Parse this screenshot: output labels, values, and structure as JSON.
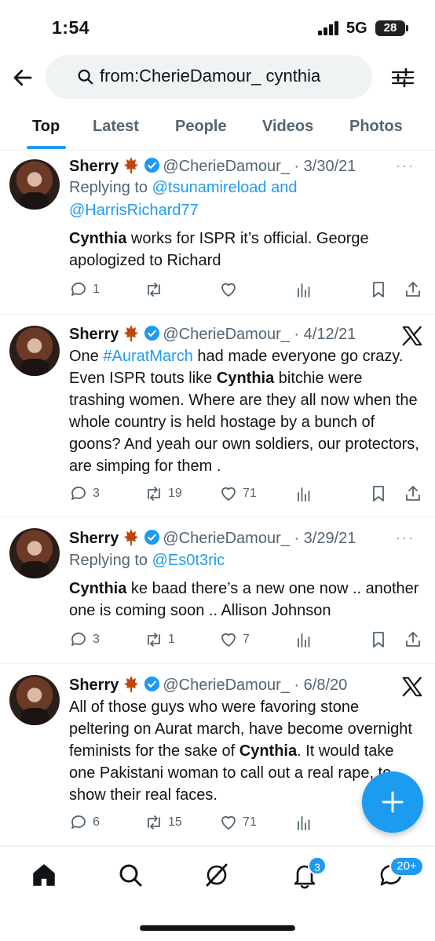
{
  "status": {
    "time": "1:54",
    "network": "5G",
    "battery": "28"
  },
  "search": {
    "query": "from:CherieDamour_ cynthia"
  },
  "tabs": [
    {
      "label": "Top"
    },
    {
      "label": "Latest"
    },
    {
      "label": "People"
    },
    {
      "label": "Videos"
    },
    {
      "label": "Photos"
    }
  ],
  "tweets": [
    {
      "name": "Sherry",
      "handle": "@CherieDamour_",
      "date": "3/30/21",
      "reply_prefix": "Replying to ",
      "reply_to_1": "@tsunamireload",
      "reply_and": " and",
      "reply_to_2": "@HarrisRichard77",
      "text_bold": "Cynthia",
      "text_rest": " works for ISPR it’s official. George apologized to Richard",
      "replies": "1",
      "retweets": "",
      "likes": ""
    },
    {
      "name": "Sherry",
      "handle": "@CherieDamour_",
      "date": "4/12/21",
      "text_1": "One ",
      "hashtag": "#AuratMarch",
      "text_2": " had made everyone go crazy. Even ISPR touts like ",
      "text_bold": "Cynthia",
      "text_3": " bitchie were trashing women. Where are they all now when the whole country is held hostage by a bunch of goons? And yeah our own soldiers, our protectors, are simping for them .",
      "replies": "3",
      "retweets": "19",
      "likes": "71"
    },
    {
      "name": "Sherry",
      "handle": "@CherieDamour_",
      "date": "3/29/21",
      "reply_prefix": "Replying to ",
      "reply_to_1": "@Es0t3ric",
      "text_bold": "Cynthia",
      "text_rest": " ke baad there’s a new one now .. another one is coming soon .. Allison Johnson",
      "replies": "3",
      "retweets": "1",
      "likes": "7"
    },
    {
      "name": "Sherry",
      "handle": "@CherieDamour_",
      "date": "6/8/20",
      "text_1": "All of those guys who were favoring stone peltering on Aurat march, have become overnight feminists for the sake of ",
      "text_bold": "Cynthia",
      "text_2": ". It would take one Pakistani woman to call out a real rape, to show their real faces.",
      "replies": "6",
      "retweets": "15",
      "likes": "71"
    }
  ],
  "separator": " · ",
  "more": "···",
  "nav": {
    "notifications_count": "3",
    "messages_count": "20+"
  },
  "colors": {
    "accent": "#1d9bf0",
    "text": "#0f1419",
    "muted": "#536471",
    "leaf": "#c1440e"
  }
}
